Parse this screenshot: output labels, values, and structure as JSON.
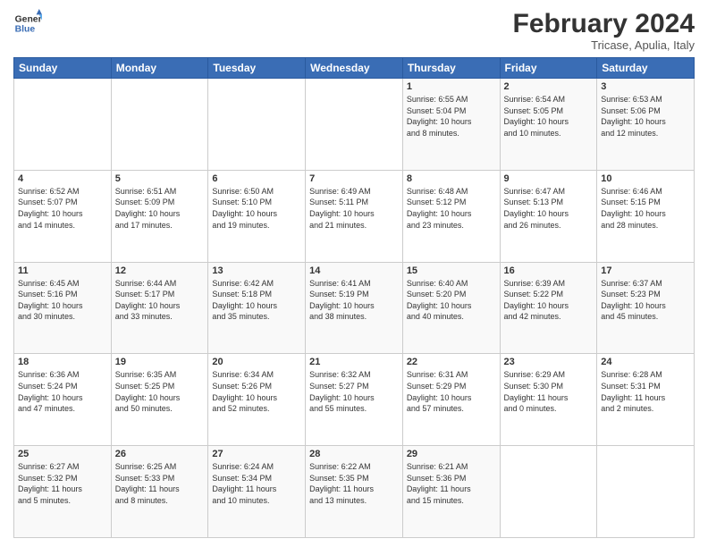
{
  "logo": {
    "line1": "General",
    "line2": "Blue"
  },
  "title": "February 2024",
  "subtitle": "Tricase, Apulia, Italy",
  "days_of_week": [
    "Sunday",
    "Monday",
    "Tuesday",
    "Wednesday",
    "Thursday",
    "Friday",
    "Saturday"
  ],
  "weeks": [
    [
      {
        "day": "",
        "info": ""
      },
      {
        "day": "",
        "info": ""
      },
      {
        "day": "",
        "info": ""
      },
      {
        "day": "",
        "info": ""
      },
      {
        "day": "1",
        "info": "Sunrise: 6:55 AM\nSunset: 5:04 PM\nDaylight: 10 hours\nand 8 minutes."
      },
      {
        "day": "2",
        "info": "Sunrise: 6:54 AM\nSunset: 5:05 PM\nDaylight: 10 hours\nand 10 minutes."
      },
      {
        "day": "3",
        "info": "Sunrise: 6:53 AM\nSunset: 5:06 PM\nDaylight: 10 hours\nand 12 minutes."
      }
    ],
    [
      {
        "day": "4",
        "info": "Sunrise: 6:52 AM\nSunset: 5:07 PM\nDaylight: 10 hours\nand 14 minutes."
      },
      {
        "day": "5",
        "info": "Sunrise: 6:51 AM\nSunset: 5:09 PM\nDaylight: 10 hours\nand 17 minutes."
      },
      {
        "day": "6",
        "info": "Sunrise: 6:50 AM\nSunset: 5:10 PM\nDaylight: 10 hours\nand 19 minutes."
      },
      {
        "day": "7",
        "info": "Sunrise: 6:49 AM\nSunset: 5:11 PM\nDaylight: 10 hours\nand 21 minutes."
      },
      {
        "day": "8",
        "info": "Sunrise: 6:48 AM\nSunset: 5:12 PM\nDaylight: 10 hours\nand 23 minutes."
      },
      {
        "day": "9",
        "info": "Sunrise: 6:47 AM\nSunset: 5:13 PM\nDaylight: 10 hours\nand 26 minutes."
      },
      {
        "day": "10",
        "info": "Sunrise: 6:46 AM\nSunset: 5:15 PM\nDaylight: 10 hours\nand 28 minutes."
      }
    ],
    [
      {
        "day": "11",
        "info": "Sunrise: 6:45 AM\nSunset: 5:16 PM\nDaylight: 10 hours\nand 30 minutes."
      },
      {
        "day": "12",
        "info": "Sunrise: 6:44 AM\nSunset: 5:17 PM\nDaylight: 10 hours\nand 33 minutes."
      },
      {
        "day": "13",
        "info": "Sunrise: 6:42 AM\nSunset: 5:18 PM\nDaylight: 10 hours\nand 35 minutes."
      },
      {
        "day": "14",
        "info": "Sunrise: 6:41 AM\nSunset: 5:19 PM\nDaylight: 10 hours\nand 38 minutes."
      },
      {
        "day": "15",
        "info": "Sunrise: 6:40 AM\nSunset: 5:20 PM\nDaylight: 10 hours\nand 40 minutes."
      },
      {
        "day": "16",
        "info": "Sunrise: 6:39 AM\nSunset: 5:22 PM\nDaylight: 10 hours\nand 42 minutes."
      },
      {
        "day": "17",
        "info": "Sunrise: 6:37 AM\nSunset: 5:23 PM\nDaylight: 10 hours\nand 45 minutes."
      }
    ],
    [
      {
        "day": "18",
        "info": "Sunrise: 6:36 AM\nSunset: 5:24 PM\nDaylight: 10 hours\nand 47 minutes."
      },
      {
        "day": "19",
        "info": "Sunrise: 6:35 AM\nSunset: 5:25 PM\nDaylight: 10 hours\nand 50 minutes."
      },
      {
        "day": "20",
        "info": "Sunrise: 6:34 AM\nSunset: 5:26 PM\nDaylight: 10 hours\nand 52 minutes."
      },
      {
        "day": "21",
        "info": "Sunrise: 6:32 AM\nSunset: 5:27 PM\nDaylight: 10 hours\nand 55 minutes."
      },
      {
        "day": "22",
        "info": "Sunrise: 6:31 AM\nSunset: 5:29 PM\nDaylight: 10 hours\nand 57 minutes."
      },
      {
        "day": "23",
        "info": "Sunrise: 6:29 AM\nSunset: 5:30 PM\nDaylight: 11 hours\nand 0 minutes."
      },
      {
        "day": "24",
        "info": "Sunrise: 6:28 AM\nSunset: 5:31 PM\nDaylight: 11 hours\nand 2 minutes."
      }
    ],
    [
      {
        "day": "25",
        "info": "Sunrise: 6:27 AM\nSunset: 5:32 PM\nDaylight: 11 hours\nand 5 minutes."
      },
      {
        "day": "26",
        "info": "Sunrise: 6:25 AM\nSunset: 5:33 PM\nDaylight: 11 hours\nand 8 minutes."
      },
      {
        "day": "27",
        "info": "Sunrise: 6:24 AM\nSunset: 5:34 PM\nDaylight: 11 hours\nand 10 minutes."
      },
      {
        "day": "28",
        "info": "Sunrise: 6:22 AM\nSunset: 5:35 PM\nDaylight: 11 hours\nand 13 minutes."
      },
      {
        "day": "29",
        "info": "Sunrise: 6:21 AM\nSunset: 5:36 PM\nDaylight: 11 hours\nand 15 minutes."
      },
      {
        "day": "",
        "info": ""
      },
      {
        "day": "",
        "info": ""
      }
    ]
  ]
}
